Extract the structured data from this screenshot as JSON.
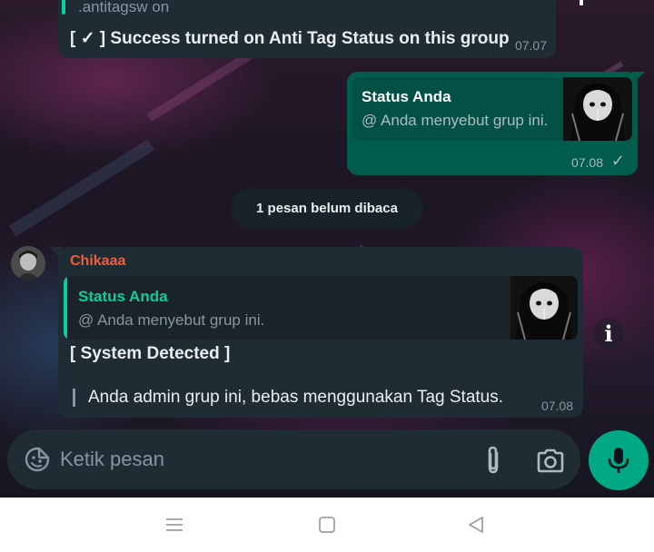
{
  "messages": {
    "top": {
      "quoted_text": ".antitagsw on",
      "body": "[ ✓ ] Success turned on Anti Tag Status on this group",
      "time": "07.07"
    },
    "outgoing": {
      "reply_title": "Status Anda",
      "reply_subtitle": "@ Anda menyebut grup ini.",
      "time": "07.08",
      "check": "✓"
    },
    "unread": "1 pesan belum dibaca",
    "incoming": {
      "sender": "Chikaaa",
      "reply_title": "Status Anda",
      "reply_subtitle": "@ Anda menyebut grup ini.",
      "heading": "[ System Detected ]",
      "body": "Anda admin grup ini, bebas menggunakan Tag Status.",
      "time": "07.08"
    }
  },
  "composer": {
    "placeholder": "Ketik pesan"
  },
  "info_button": "i",
  "colors": {
    "outgoing_bubble": "#005c4b",
    "incoming_bubble": "#202c33",
    "accent_green": "#00a884",
    "sender_name": "#f15c3a",
    "quote_green": "#06cf9c"
  },
  "icons": {
    "emoji": "sticker-icon",
    "attach": "paperclip-icon",
    "camera": "camera-icon",
    "mic": "microphone-icon",
    "nav_menu": "recent-apps-icon",
    "nav_home": "home-icon",
    "nav_back": "back-icon"
  }
}
